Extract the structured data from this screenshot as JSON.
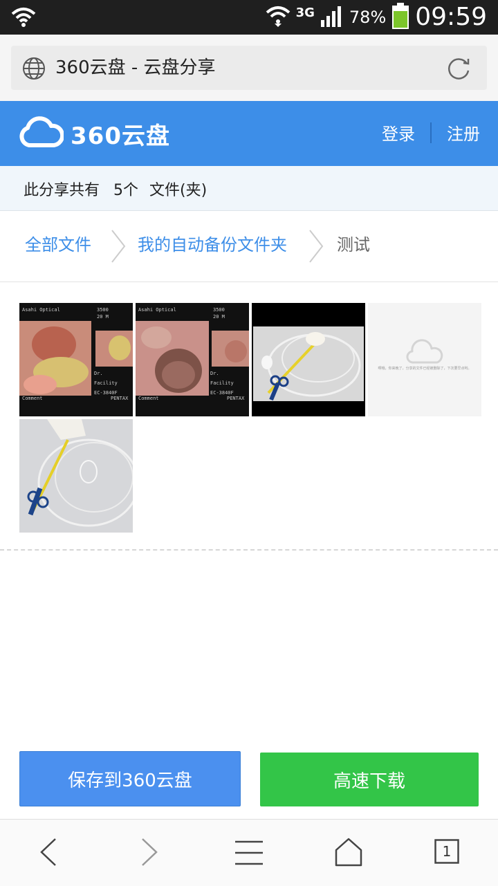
{
  "status_bar": {
    "network": "3G",
    "battery": "78%",
    "time": "09:59"
  },
  "browser": {
    "page_title": "360云盘 - 云盘分享",
    "tab_count": "1"
  },
  "header": {
    "logo_text": "360云盘",
    "login": "登录",
    "register": "注册"
  },
  "summary": {
    "prefix": "此分享共有",
    "count": "5个",
    "suffix": "文件(夹)"
  },
  "breadcrumb": {
    "items": [
      "全部文件",
      "我的自动备份文件夹",
      "测试"
    ]
  },
  "thumbnails": [
    {
      "kind": "endoscopy-image",
      "overlay": [
        "Asahi Optical",
        "3500",
        "20  M",
        "Dr.",
        "Facility",
        "EC-3840F",
        "PENTAX",
        "Comment"
      ]
    },
    {
      "kind": "endoscopy-image",
      "overlay": [
        "Asahi Optical",
        "3500",
        "20  M",
        "Dr.",
        "Facility",
        "EC-3840F",
        "PENTAX",
        "Comment"
      ]
    },
    {
      "kind": "video-frame-snare"
    },
    {
      "kind": "placeholder",
      "message": "啊哦，你来晚了，分享的文件已经被删除了，下次要早点哟。"
    },
    {
      "kind": "photo-snare"
    }
  ],
  "actions": {
    "save": "保存到360云盘",
    "download": "高速下载"
  },
  "colors": {
    "brand_blue": "#3d8ee8",
    "save_blue": "#4b90ef",
    "download_green": "#33c548"
  }
}
